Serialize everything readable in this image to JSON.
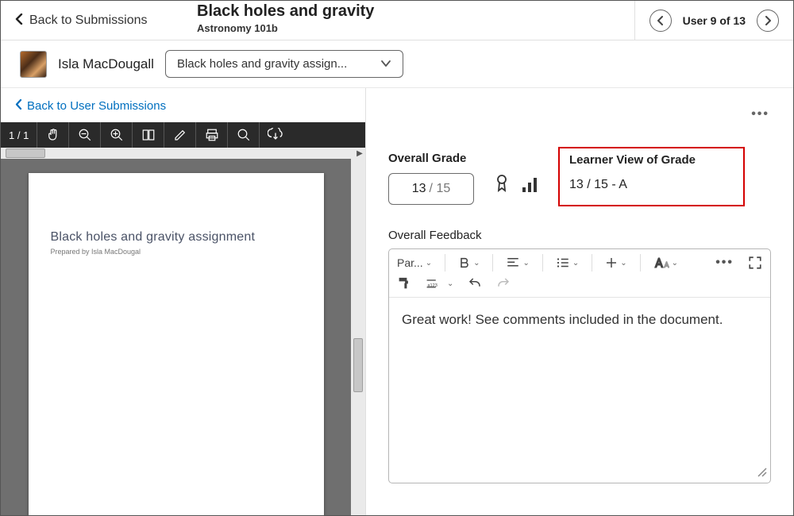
{
  "header": {
    "back_label": "Back to Submissions",
    "title": "Black holes and gravity",
    "course": "Astronomy 101b",
    "user_count_label": "User 9 of 13"
  },
  "subheader": {
    "user_name": "Isla MacDougall",
    "assignment_dd": "Black holes and gravity assign..."
  },
  "left": {
    "back_user_label": "Back to User Submissions",
    "page_indicator": "1 / 1",
    "doc_title": "Black holes and gravity assignment",
    "doc_subtitle": "Prepared by Isla MacDougal"
  },
  "right": {
    "more_dots": "•••",
    "overall_grade_label": "Overall Grade",
    "grade_score": "13",
    "grade_max": "/ 15",
    "learner_view_label": "Learner View of Grade",
    "learner_view_value": "13 / 15 - A",
    "overall_feedback_label": "Overall Feedback",
    "editor": {
      "para_label": "Par...",
      "feedback_text": "Great work! See comments included in the document."
    }
  }
}
